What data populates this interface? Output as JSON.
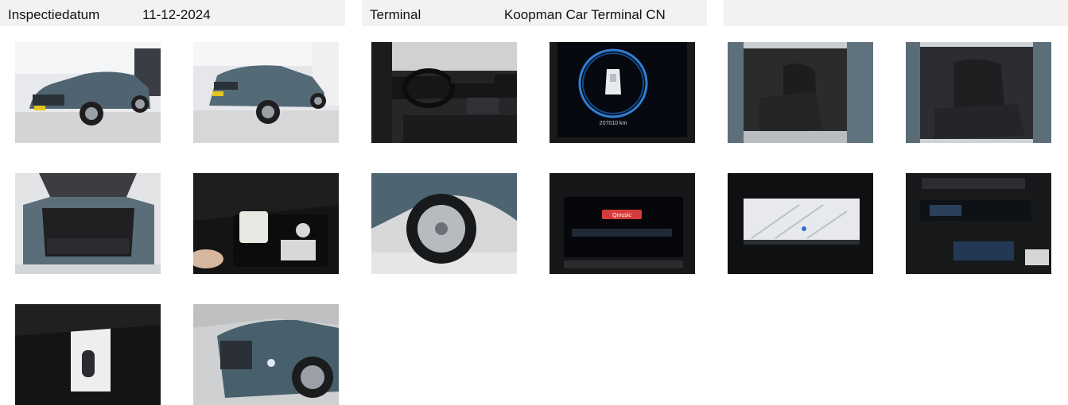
{
  "header": {
    "inspection_label": "Inspectiedatum",
    "inspection_date": "11-12-2024",
    "terminal_label": "Terminal",
    "terminal_value": "Koopman Car Terminal CN"
  },
  "photos": [
    {
      "id": "photo-front-left-exterior",
      "subject": "car exterior front-left"
    },
    {
      "id": "photo-rear-left-exterior",
      "subject": "car exterior rear-left"
    },
    {
      "id": "photo-dashboard",
      "subject": "dashboard and steering wheel"
    },
    {
      "id": "photo-odometer",
      "subject": "instrument cluster odometer",
      "odometer_text": "207010 km"
    },
    {
      "id": "photo-front-seats",
      "subject": "front seats through open door"
    },
    {
      "id": "photo-rear-seats",
      "subject": "rear seats through open door"
    },
    {
      "id": "photo-trunk",
      "subject": "open trunk"
    },
    {
      "id": "photo-repair-kit",
      "subject": "tire repair kit in trunk"
    },
    {
      "id": "photo-wheel",
      "subject": "front wheel and rim"
    },
    {
      "id": "photo-infotainment",
      "subject": "infotainment screen",
      "screen_text": "Qmusic"
    },
    {
      "id": "photo-navigation",
      "subject": "navigation map screen"
    },
    {
      "id": "photo-climate",
      "subject": "center console and climate controls"
    },
    {
      "id": "photo-keys",
      "subject": "key fob and manual"
    },
    {
      "id": "photo-front-closeup",
      "subject": "front headlight close-up"
    }
  ]
}
